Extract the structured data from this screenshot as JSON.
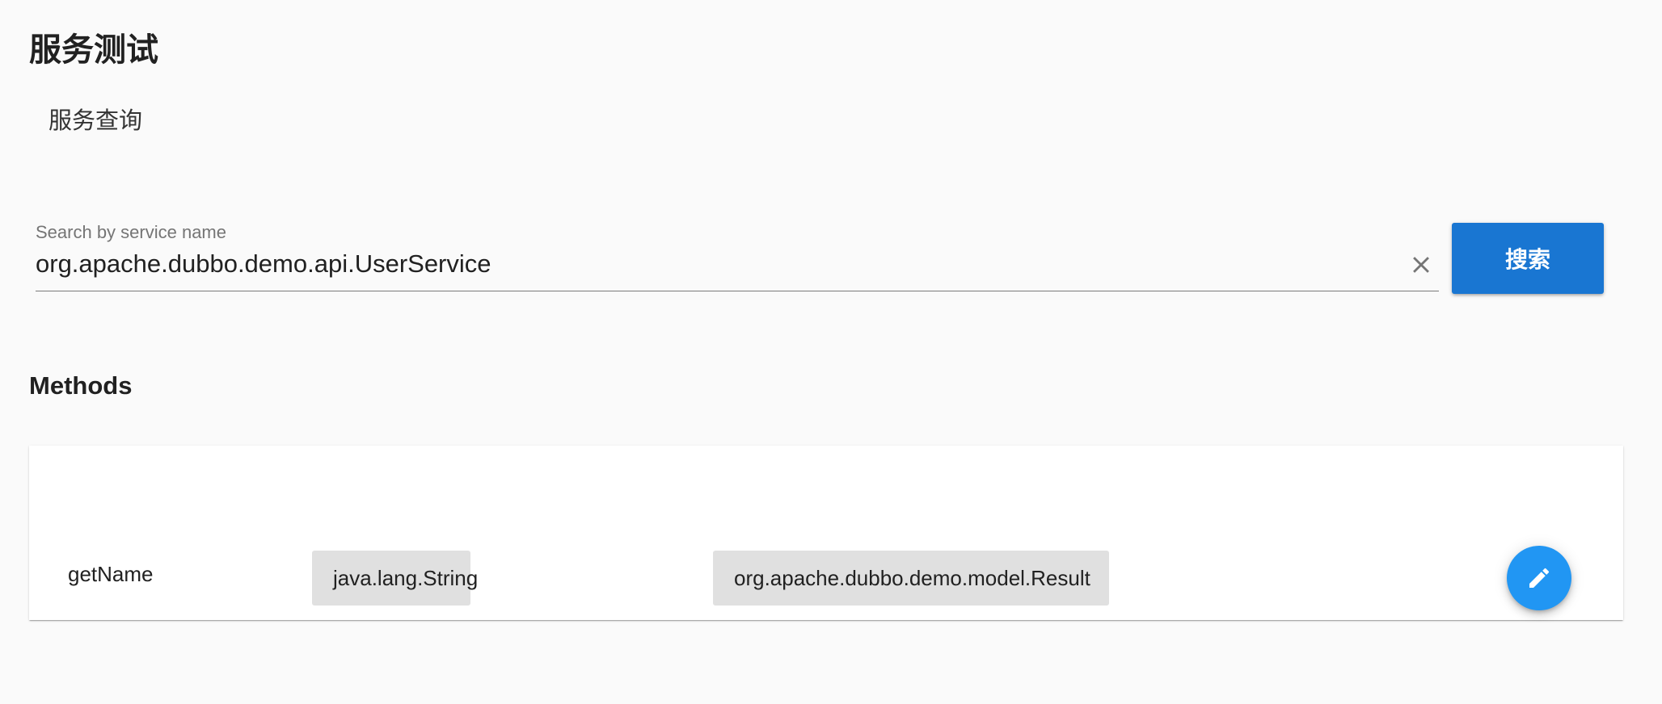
{
  "page": {
    "title": "服务测试",
    "subtitle": "服务查询"
  },
  "search": {
    "label": "Search by service name",
    "value": "org.apache.dubbo.demo.api.UserService",
    "clear_icon": "close-icon",
    "button_label": "搜索",
    "button_color": "#1976d2"
  },
  "methods": {
    "title": "Methods",
    "rows": [
      {
        "name": "getName",
        "parameter_types": [
          "java.lang.String"
        ],
        "return_type": "org.apache.dubbo.demo.model.Result",
        "action_icon": "pencil-icon",
        "action_color": "#2196f3"
      }
    ]
  }
}
